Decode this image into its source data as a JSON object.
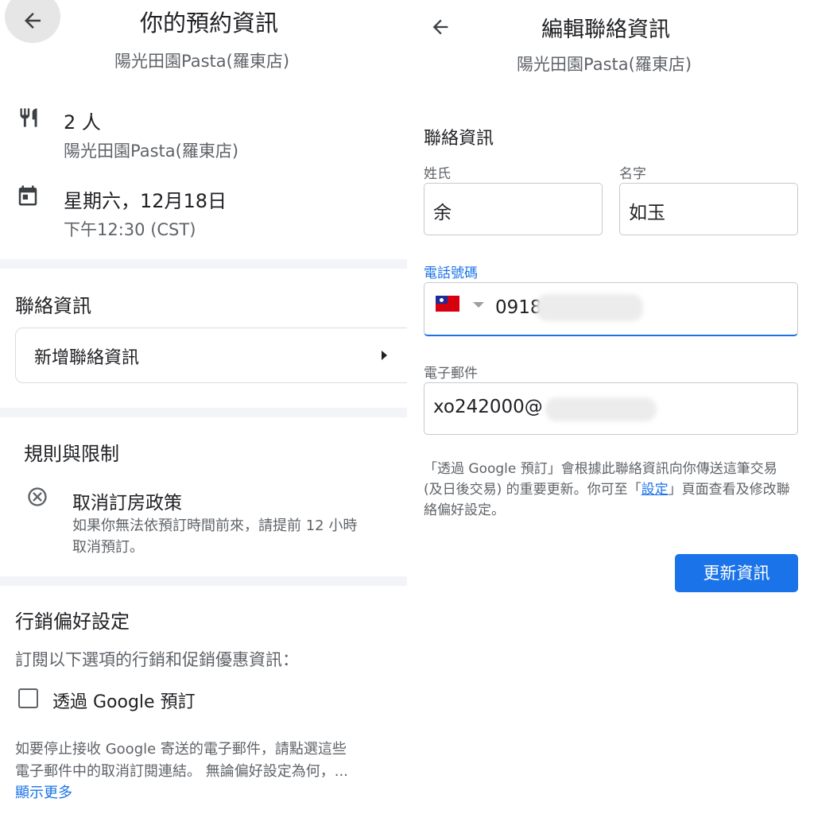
{
  "left": {
    "header": {
      "title": "你的預約資訊",
      "subtitle": "陽光田園Pasta(羅東店)"
    },
    "party": {
      "size": "2 人",
      "restaurant": "陽光田園Pasta(羅東店)"
    },
    "date": {
      "day": "星期六，12月18日",
      "time": "下午12:30 (CST)"
    },
    "contact": {
      "section_title": "聯絡資訊",
      "add_label": "新增聯絡資訊"
    },
    "rules": {
      "section_title": "規則與限制",
      "policy_title": "取消訂房政策",
      "policy_line1": "如果你無法依預訂時間前來，請提前 12 小時",
      "policy_line2": "取消預訂。"
    },
    "marketing": {
      "section_title": "行銷偏好設定",
      "intro": "訂閱以下選項的行銷和促銷優惠資訊：",
      "checkbox_label": "透過 Google 預訂",
      "note_line1": "如要停止接收 Google 寄送的電子郵件，請點選這些",
      "note_line2": "電子郵件中的取消訂閱連結。 無論偏好設定為何，...",
      "show_more": "顯示更多"
    }
  },
  "right": {
    "header": {
      "title": "編輯聯絡資訊",
      "subtitle": "陽光田園Pasta(羅東店)"
    },
    "section_title": "聯絡資訊",
    "last_name": {
      "label": "姓氏",
      "value": "余"
    },
    "first_name": {
      "label": "名字",
      "value": "如玉"
    },
    "phone": {
      "label": "電話號碼",
      "value": "0918"
    },
    "email": {
      "label": "電子郵件",
      "value": "xo242000@"
    },
    "notice": {
      "before": "「透過 Google 預訂」會根據此聯絡資訊向你傳送這筆交易 (及日後交易) 的重要更新。你可至「",
      "link": "設定",
      "after": "」頁面查看及修改聯絡偏好設定。"
    },
    "update_button": "更新資訊"
  },
  "colors": {
    "accent": "#1a73e8",
    "separator": "#f3f4f7",
    "secondary_text": "#5f6368"
  }
}
